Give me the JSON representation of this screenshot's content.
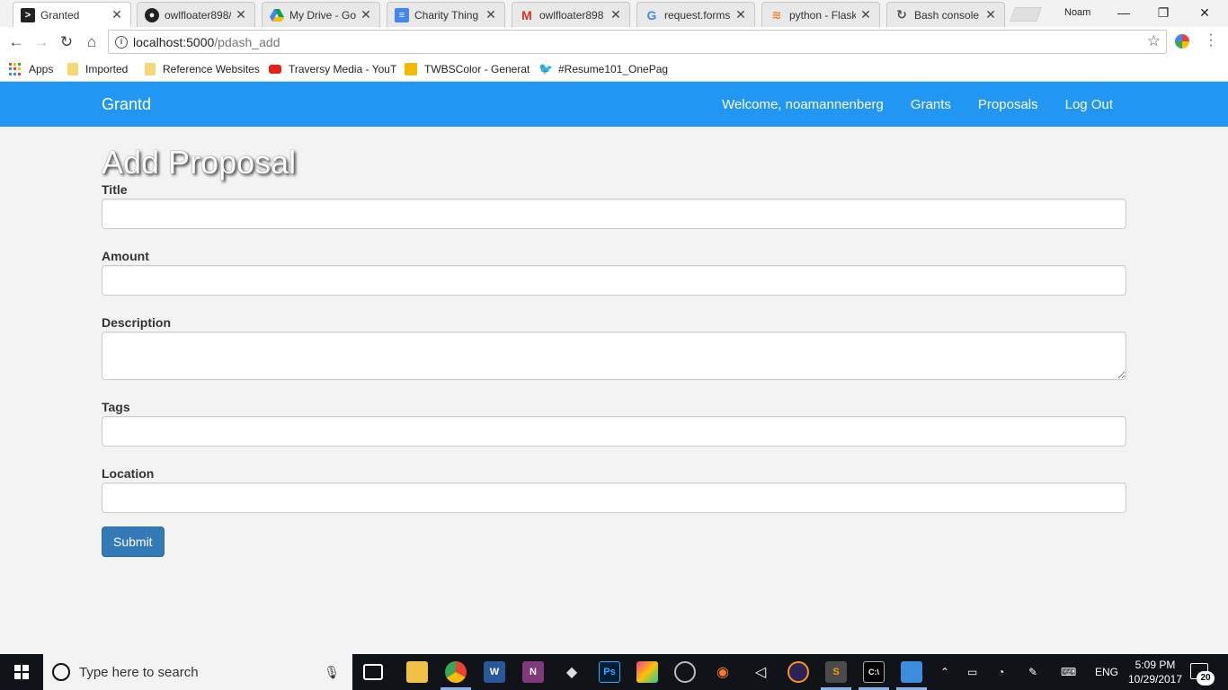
{
  "browser": {
    "profile_name": "Noam",
    "tabs": [
      {
        "title": "Granted",
        "icon": "terminal-favicon",
        "active": true
      },
      {
        "title": "owlfloater898/",
        "icon": "github-favicon"
      },
      {
        "title": "My Drive - Goo",
        "icon": "google-drive-favicon"
      },
      {
        "title": "Charity Thing -",
        "icon": "google-docs-favicon"
      },
      {
        "title": "owlfloater898",
        "icon": "gmail-favicon"
      },
      {
        "title": "request.forms.",
        "icon": "google-favicon"
      },
      {
        "title": "python - Flask",
        "icon": "stackoverflow-favicon"
      },
      {
        "title": "Bash console",
        "icon": "pythonanywhere-favicon"
      }
    ],
    "url_host": "localhost:5000",
    "url_path": "/pdash_add",
    "bookmarks": [
      {
        "label": "Apps",
        "icon": "apps-grid-icon"
      },
      {
        "label": "Imported",
        "icon": "folder-icon"
      },
      {
        "label": "Reference Websites",
        "icon": "folder-icon"
      },
      {
        "label": "Traversy Media - YouT",
        "icon": "youtube-icon"
      },
      {
        "label": "TWBSColor - Generat",
        "icon": "twbscolor-icon"
      },
      {
        "label": "#Resume101_OnePag",
        "icon": "twitter-icon"
      }
    ]
  },
  "site": {
    "brand": "Grantd",
    "nav": {
      "welcome": "Welcome, noamannenberg",
      "grants": "Grants",
      "proposals": "Proposals",
      "logout": "Log Out"
    },
    "navbar_color": "#2196f3"
  },
  "form": {
    "title": "Add Proposal",
    "fields": {
      "title_label": "Title",
      "title_value": "",
      "amount_label": "Amount",
      "amount_value": "",
      "description_label": "Description",
      "description_value": "",
      "tags_label": "Tags",
      "tags_value": "",
      "location_label": "Location",
      "location_value": ""
    },
    "submit_label": "Submit",
    "submit_color": "#337ab7"
  },
  "taskbar": {
    "search_placeholder": "Type here to search",
    "language": "ENG",
    "time": "5:09 PM",
    "date": "10/29/2017",
    "notification_count": "20",
    "pinned": [
      "task-view-icon",
      "file-explorer-icon",
      "chrome-icon",
      "word-icon",
      "onenote-icon",
      "inkscape-icon",
      "photoshop-icon",
      "affinity-icon",
      "ubuntu-icon",
      "blender-icon",
      "unity-icon",
      "eclipse-icon",
      "sublime-text-icon",
      "cmd-icon",
      "control-panel-icon"
    ]
  }
}
